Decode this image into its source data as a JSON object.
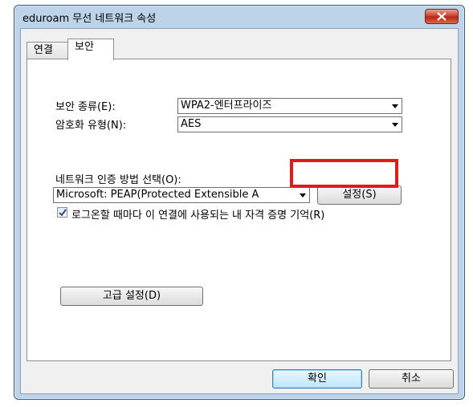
{
  "window": {
    "title": "eduroam 무선 네트워크 속성"
  },
  "tabs": [
    {
      "label": "연결"
    },
    {
      "label": "보안"
    }
  ],
  "security": {
    "type_label": "보안 종류(E):",
    "type_value": "WPA2-엔터프라이즈",
    "encryption_label": "암호화 유형(N):",
    "encryption_value": "AES",
    "auth_method_label": "네트워크 인증 방법 선택(O):",
    "auth_method_value": "Microsoft: PEAP(Protected Extensible A",
    "settings_button": "설정(S)",
    "remember_checkbox_label": "로그온할 때마다 이 연결에 사용되는 내 자격 증명 기억(R)",
    "remember_checked": true,
    "advanced_button": "고급 설정(D)"
  },
  "footer": {
    "ok_button": "확인",
    "cancel_button": "취소"
  },
  "colors": {
    "highlight": "#e21a1a"
  }
}
